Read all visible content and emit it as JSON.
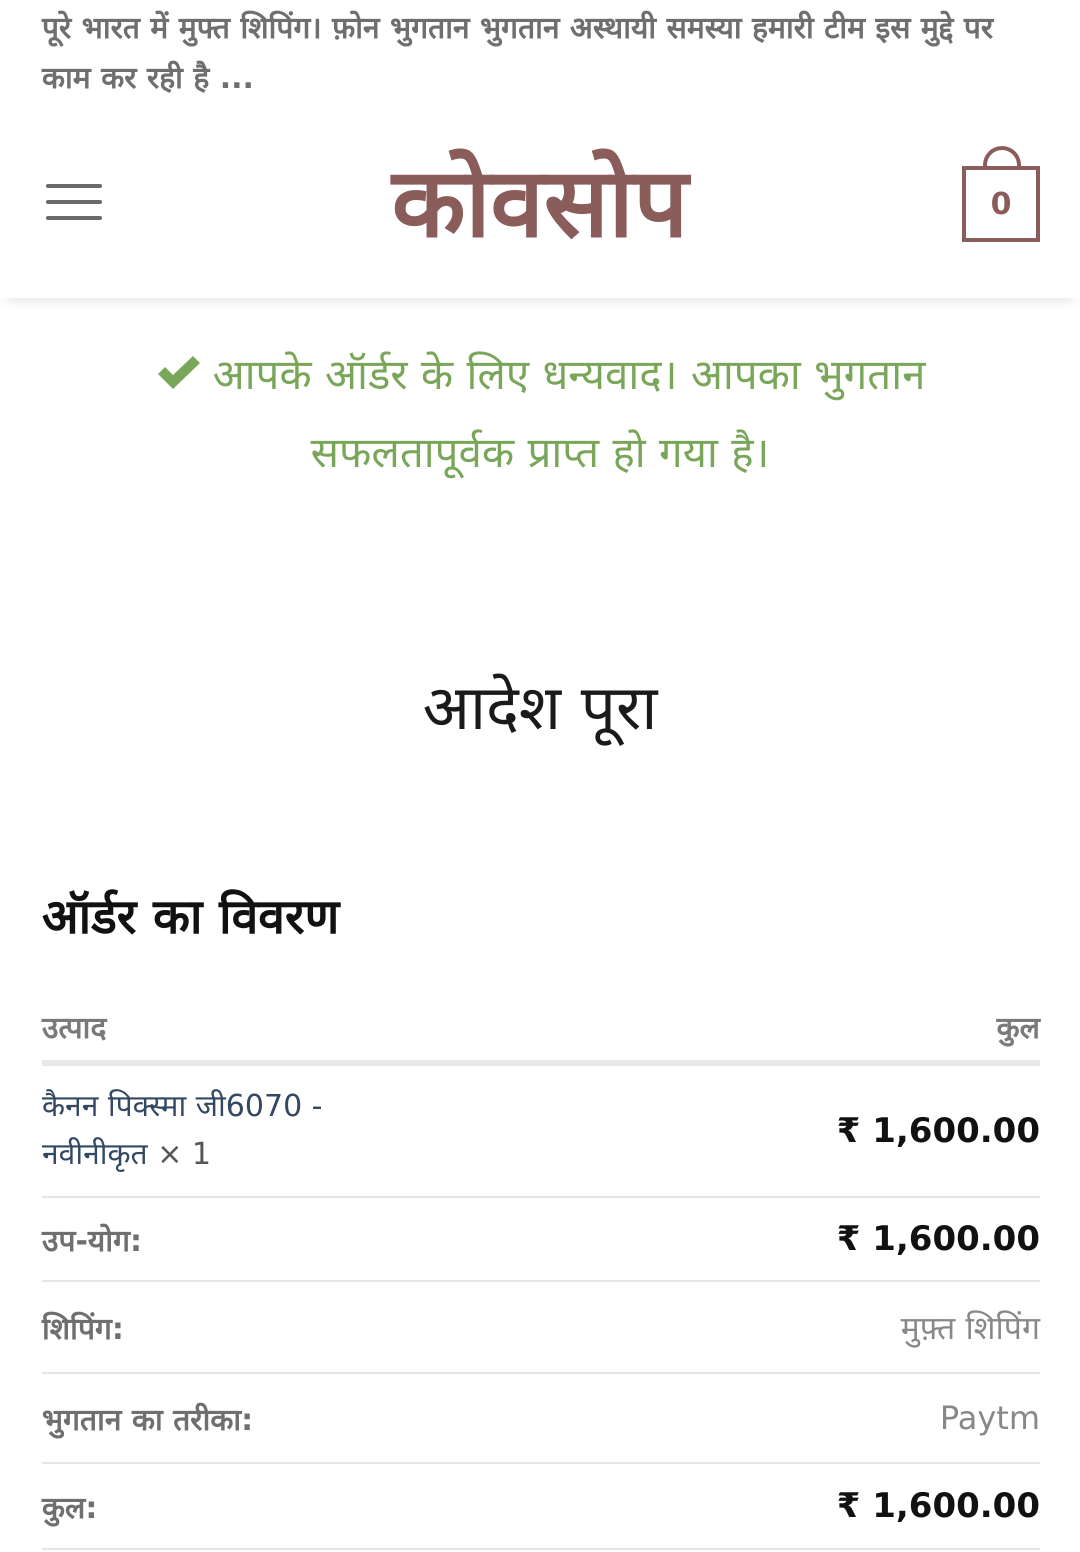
{
  "notice": {
    "text": "पूरे भारत में मुफ्त शिपिंग। फ़ोन भुगतान भुगतान अस्थायी समस्या हमारी टीम इस मुद्दे पर काम कर रही है ..."
  },
  "header": {
    "logo": "कोवसोप",
    "menu_icon": "hamburger-icon",
    "cart_icon": "shopping-bag-icon",
    "cart_count": "0",
    "brand_color": "#8a5d5b"
  },
  "success": {
    "icon": "checkmark-icon",
    "line1": "आपके ऑर्डर के लिए धन्यवाद। आपका भुगतान",
    "line2": "सफलतापूर्वक प्राप्त हो गया है।",
    "color": "#7aa65a"
  },
  "page": {
    "title": "आदेश पूरा"
  },
  "order": {
    "heading": "ऑर्डर का विवरण",
    "columns": {
      "product": "उत्पाद",
      "total": "कुल"
    },
    "item": {
      "name_line1": "कैनन पिक्स्मा जी6070 -",
      "name_line2": "नवीनीकृत",
      "quantity": "× 1",
      "price": "₹ 1,600.00"
    },
    "subtotal": {
      "label": "उप-योग:",
      "value": "₹ 1,600.00"
    },
    "shipping": {
      "label": "शिपिंग:",
      "value": "मुफ़्त शिपिंग"
    },
    "payment_method": {
      "label": "भुगतान का तरीका:",
      "value": "Paytm"
    },
    "total": {
      "label": "कुल:",
      "value": "₹ 1,600.00"
    }
  }
}
